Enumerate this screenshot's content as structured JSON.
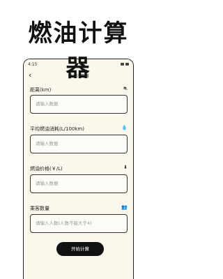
{
  "promo": {
    "title_line1": "燃油计算",
    "title_line2": "器"
  },
  "status_bar": {
    "time": "4:15"
  },
  "app_bar": {
    "back": "‹",
    "title": "燃油计算器"
  },
  "form": {
    "fields": [
      {
        "label": "距离(km)",
        "placeholder": "请输入数据",
        "icon": "route-icon",
        "glyph": "⛐"
      },
      {
        "label": "平均燃油消耗(L/100km)",
        "placeholder": "请输入数据",
        "icon": "fuel-drop-icon",
        "glyph": "💧"
      },
      {
        "label": "燃油价格(￥/L)",
        "placeholder": "请输入数据",
        "icon": "price-tag-icon",
        "glyph": "⬇"
      },
      {
        "label": "乘客数量",
        "placeholder": "请输入人数(人数不能大于4)",
        "icon": "people-icon",
        "glyph": "👥"
      }
    ],
    "submit_label": "开始计算"
  },
  "colors": {
    "screen_bg": "#fbf7ec",
    "button_bg": "#111111",
    "button_text": "#ffffff"
  }
}
